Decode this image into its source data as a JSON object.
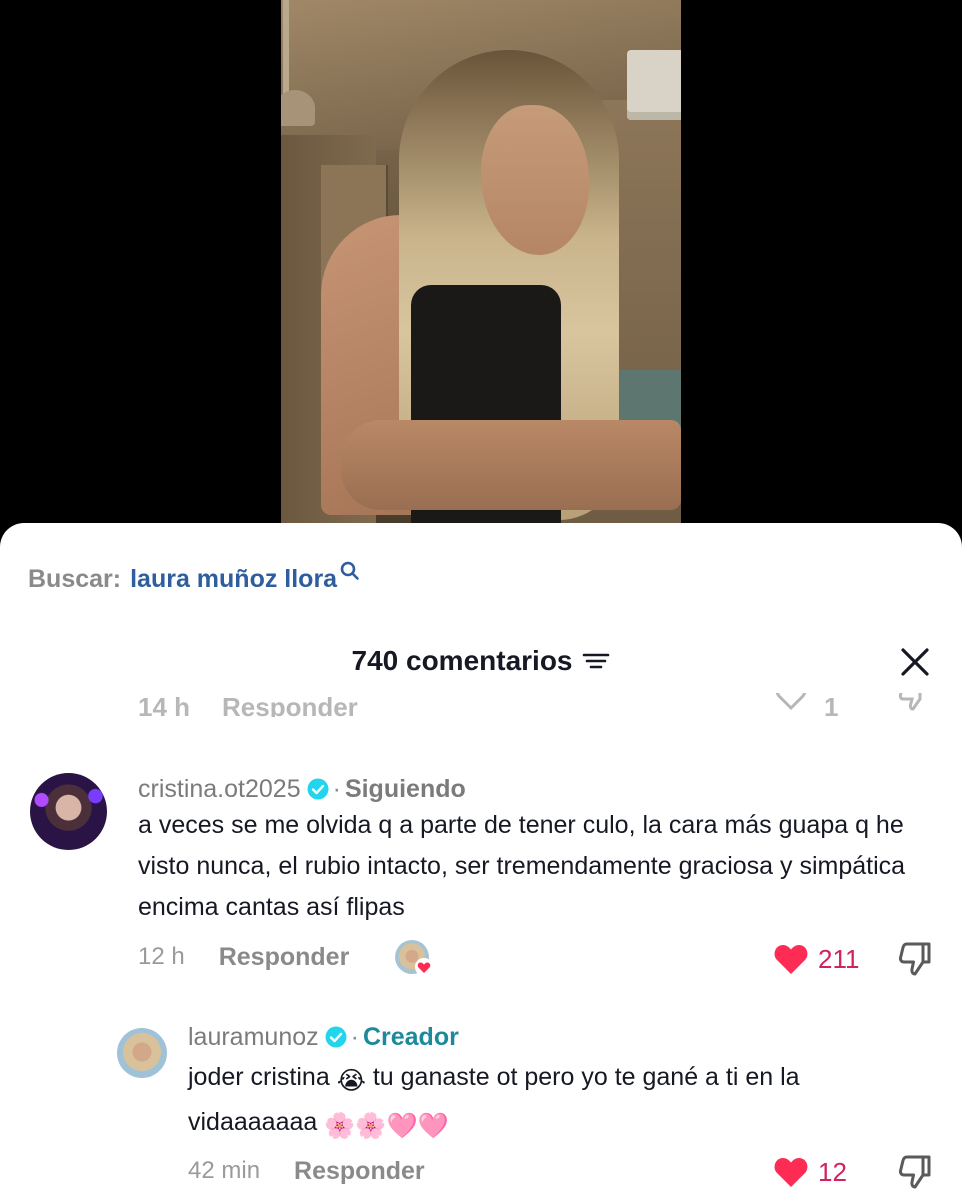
{
  "search": {
    "prefix": "Buscar:",
    "query": "laura muñoz llora"
  },
  "header": {
    "title": "740 comentarios"
  },
  "ghost_row": {
    "time": "14 h",
    "reply": "Responder"
  },
  "comments": [
    {
      "username": "cristina.ot2025",
      "separator": "·",
      "relation": "Siguiendo",
      "text": "a veces se me olvida q a parte de tener culo, la cara más guapa q he visto nunca, el rubio intacto, ser tremendamente graciosa y simpática encima cantas así flipas",
      "time": "12 h",
      "reply_label": "Responder",
      "likes": "211"
    },
    {
      "username": "lauramunoz",
      "separator": "·",
      "badge": "Creador",
      "text_part1": "joder cristina",
      "text_part2": "tu ganaste ot pero yo te gané a ti en la vidaaaaaaa",
      "emoji_loudly_crying": "😭",
      "emoji_tail": "🌸🌸🩷🩷",
      "time": "42 min",
      "reply_label": "Responder",
      "likes": "12"
    }
  ],
  "colors": {
    "accent_link": "#2f5e9e",
    "like_red": "#fe2c55",
    "like_count": "#d0245c",
    "creator_teal": "#1d8a9c",
    "verified_blue": "#20d5ec"
  }
}
